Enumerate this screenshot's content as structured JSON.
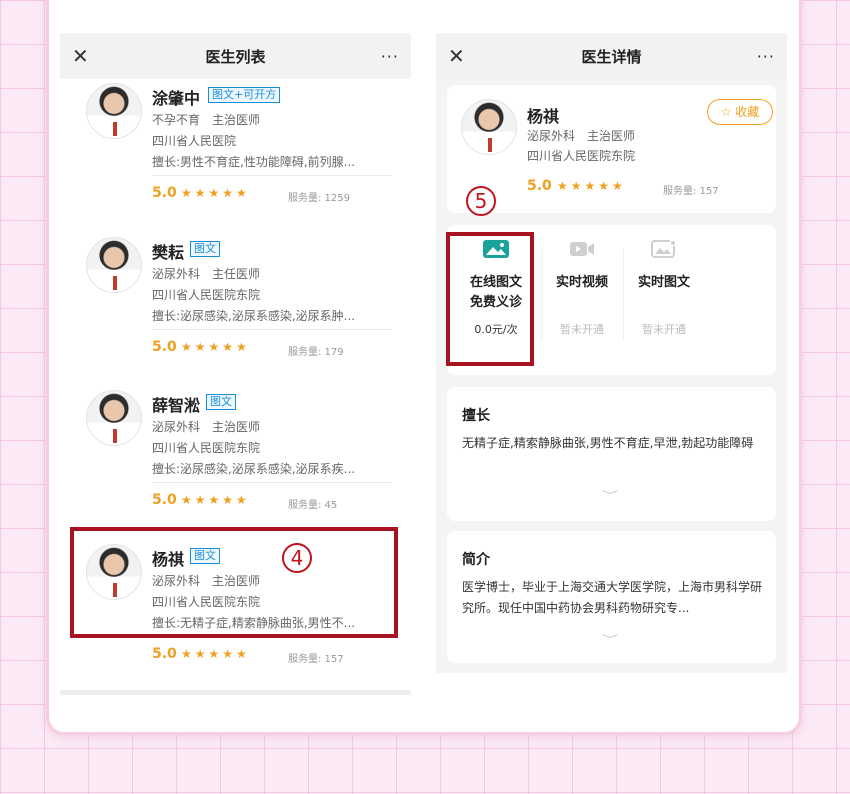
{
  "left": {
    "title": "医生列表",
    "close": "✕",
    "more": "···",
    "doctors": [
      {
        "name": "涂肇中",
        "tag": "图文+可开方",
        "dept": "不孕不育　主治医师",
        "hospital": "四川省人民医院",
        "expertise": "擅长:男性不育症,性功能障碍,前列腺...",
        "rating": "5.0",
        "stars": "★★★★★",
        "service": "服务量:  1259"
      },
      {
        "name": "樊耘",
        "tag": "图文",
        "dept": "泌尿外科　主任医师",
        "hospital": "四川省人民医院东院",
        "expertise": "擅长:泌尿感染,泌尿系感染,泌尿系肿...",
        "rating": "5.0",
        "stars": "★★★★★",
        "service": "服务量:  179"
      },
      {
        "name": "薛智淞",
        "tag": "图文",
        "dept": "泌尿外科　主治医师",
        "hospital": "四川省人民医院东院",
        "expertise": "擅长:泌尿感染,泌尿系感染,泌尿系疾...",
        "rating": "5.0",
        "stars": "★★★★★",
        "service": "服务量:  45"
      },
      {
        "name": "杨祺",
        "tag": "图文",
        "dept": "泌尿外科　主治医师",
        "hospital": "四川省人民医院东院",
        "expertise": "擅长:无精子症,精索静脉曲张,男性不...",
        "rating": "5.0",
        "stars": "★★★★★",
        "service": "服务量:  157"
      }
    ],
    "marker": "4"
  },
  "right": {
    "title": "医生详情",
    "close": "✕",
    "more": "···",
    "doctor": {
      "name": "杨祺",
      "dept": "泌尿外科　主治医师",
      "hospital": "四川省人民医院东院",
      "rating": "5.0",
      "stars": "★★★★★",
      "service": "服务量:  157",
      "favorite": "收藏"
    },
    "marker": "5",
    "services": [
      {
        "line1": "在线图文",
        "line2": "免费义诊",
        "sub": "0.0元/次",
        "icon": "image-icon",
        "active": true
      },
      {
        "line1": "实时视频",
        "line2": "",
        "sub": "暂未开通",
        "icon": "video-icon",
        "active": false
      },
      {
        "line1": "实时图文",
        "line2": "",
        "sub": "暂未开通",
        "icon": "image-edit-icon",
        "active": false
      }
    ],
    "expertise": {
      "title": "擅长",
      "body": "无精子症,精索静脉曲张,男性不育症,早泄,勃起功能障碍"
    },
    "intro": {
      "title": "简介",
      "body": "医学博士，毕业于上海交通大学医学院，上海市男科学研究所。现任中国中药协会男科药物研究专..."
    },
    "chevron": "﹀"
  },
  "colors": {
    "accent": "#f0a020",
    "highlight": "#a6121e",
    "tag_blue": "#1a8fd8",
    "active_teal": "#1aa39a"
  }
}
